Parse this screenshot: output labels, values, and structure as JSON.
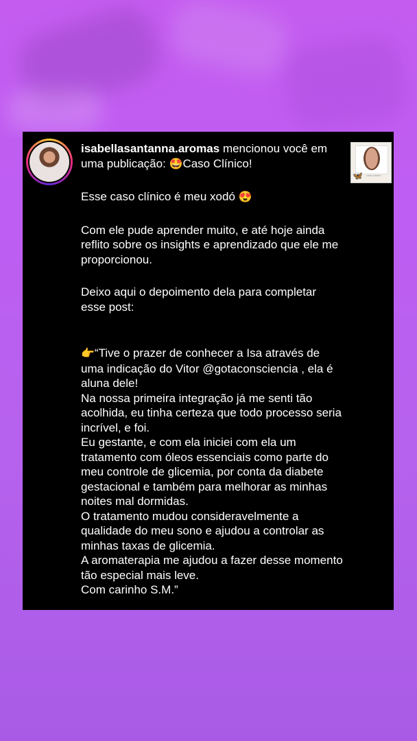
{
  "notification": {
    "username": "isabellasantanna.aromas",
    "action_text": " mencionou você em uma publicação: ",
    "post_title": "Caso Clínico!",
    "post_title_emoji": "🤩"
  },
  "thumbnail": {
    "caption": "CASO CLÍNICO"
  },
  "body": {
    "p1_text": "Esse caso clínico é meu xodó ",
    "p1_emoji": "😍",
    "p2": "Com ele pude aprender muito, e até hoje ainda reflito sobre os insights e aprendizado que ele me proporcionou.",
    "p3": "Deixo aqui o depoimento dela para completar esse post:",
    "quote_emoji": "👉",
    "quote_lines": [
      "“Tive o prazer de conhecer a Isa através de uma indicação do Vitor @gotaconsciencia , ela é aluna dele!",
      "Na nossa primeira integração já me senti tão acolhida, eu tinha certeza que todo processo seria incrível, e foi.",
      "Eu gestante, e com ela iniciei com ela um tratamento com óleos essenciais como parte do meu controle de glicemia, por conta da diabete gestacional e também para melhorar as minhas noites mal dormidas.",
      "O tratamento mudou consideravelmente a qualidade do meu sono e ajudou a controlar as minhas taxas de glicemia.",
      "A aromaterapia me ajudou a fazer desse momento tão especial mais leve.",
      "Com carinho S.M.”"
    ]
  }
}
